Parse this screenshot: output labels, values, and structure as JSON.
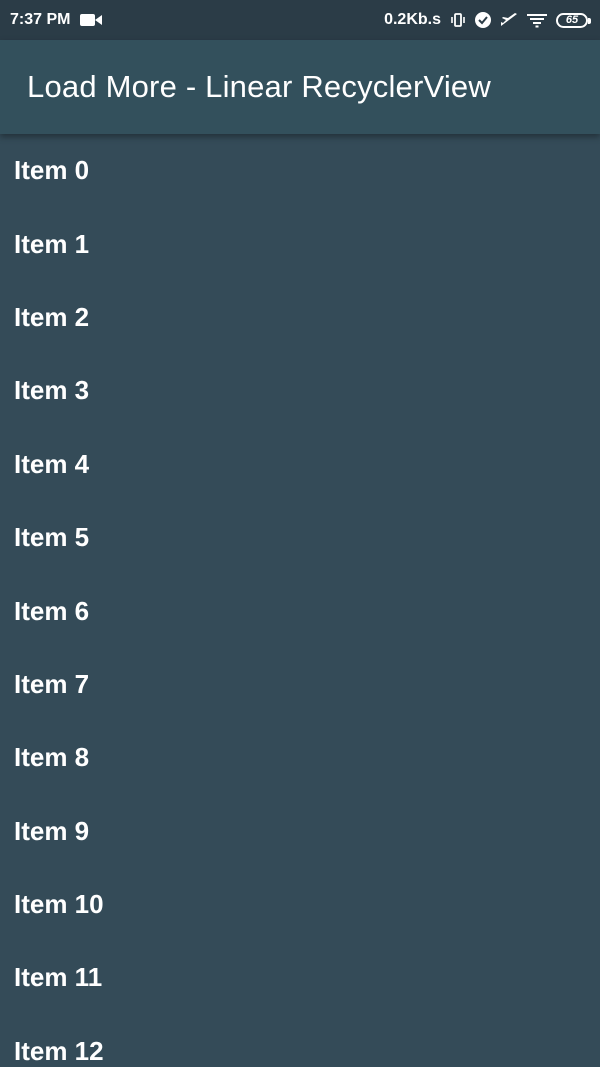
{
  "status_bar": {
    "time": "7:37 PM",
    "network_speed": "0.2Kb.s",
    "battery_level": "65",
    "icons": [
      "video-camera-icon",
      "vibrate-icon",
      "check-circle-icon",
      "airplane-icon",
      "wifi-icon",
      "battery-icon"
    ]
  },
  "app_bar": {
    "title": "Load More - Linear RecyclerView"
  },
  "list": {
    "items": [
      {
        "label": "Item 0"
      },
      {
        "label": "Item 1"
      },
      {
        "label": "Item 2"
      },
      {
        "label": "Item 3"
      },
      {
        "label": "Item 4"
      },
      {
        "label": "Item 5"
      },
      {
        "label": "Item 6"
      },
      {
        "label": "Item 7"
      },
      {
        "label": "Item 8"
      },
      {
        "label": "Item 9"
      },
      {
        "label": "Item 10"
      },
      {
        "label": "Item 11"
      },
      {
        "label": "Item 12"
      }
    ]
  },
  "colors": {
    "background": "#344b58",
    "status_bar": "#2b3c47",
    "app_bar": "#33505c",
    "text": "#ffffff"
  }
}
